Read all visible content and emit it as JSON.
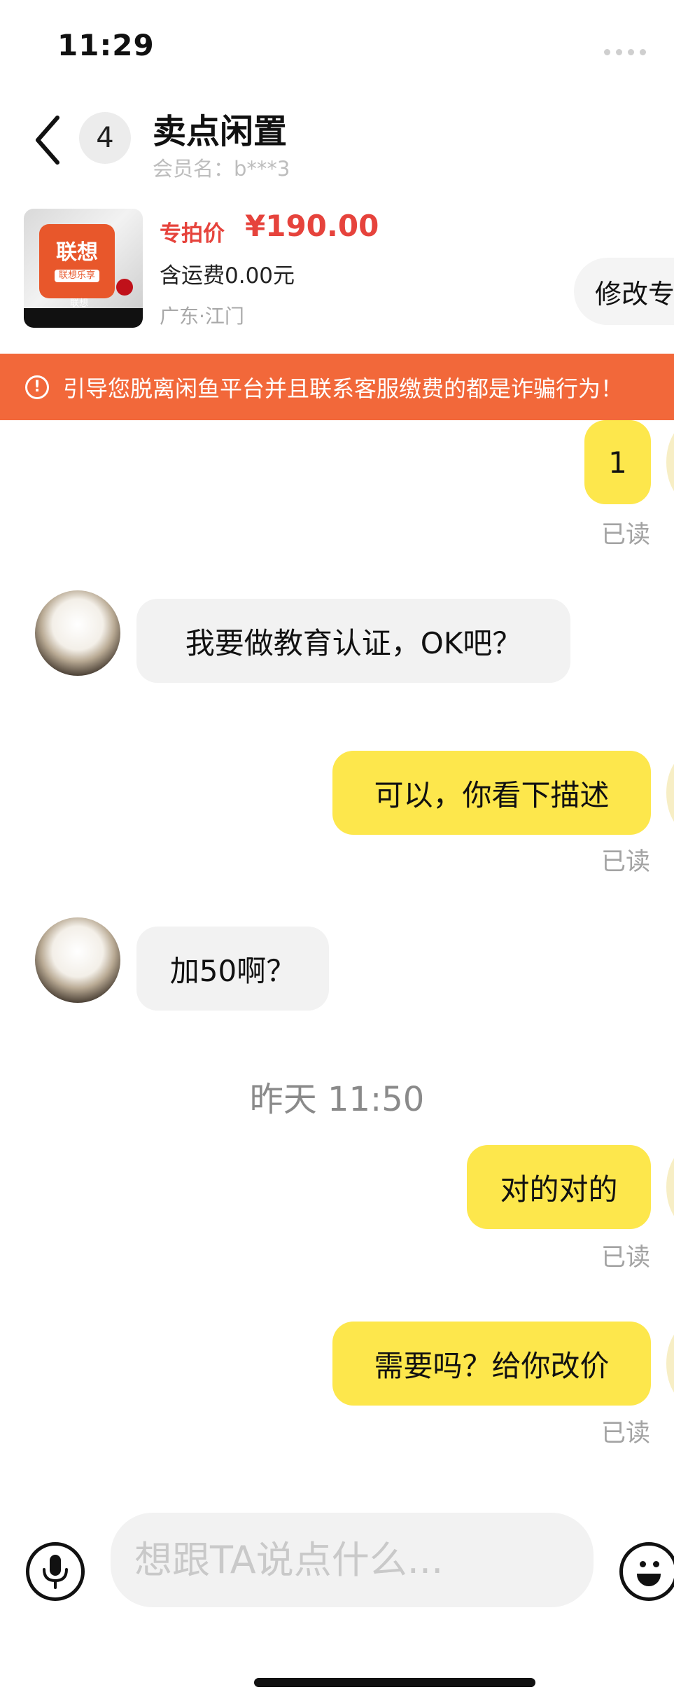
{
  "status_bar": {
    "time": "11:29"
  },
  "header": {
    "back_label": "<",
    "unread_count": "4",
    "title": "卖点闲置",
    "member": "会员名：b***3"
  },
  "product": {
    "logo_text": "联想",
    "logo_sub": "联想乐享",
    "brand_text": "联想",
    "price_label": "专拍价",
    "price": "¥190.00",
    "shipping": "含运费0.00元",
    "location": "广东·江门",
    "modify_button": "修改专"
  },
  "warning": {
    "icon": "!",
    "text": "引导您脱离闲鱼平台并且联系客服缴费的都是诈骗行为！"
  },
  "messages": [
    {
      "from": "me",
      "text": "1",
      "status": "已读"
    },
    {
      "from": "them",
      "text": "我要做教育认证，OK吧？"
    },
    {
      "from": "me",
      "text": "可以，你看下描述",
      "status": "已读"
    },
    {
      "from": "them",
      "text": "加50啊？"
    },
    {
      "from": "me",
      "text": "对的对的",
      "status": "已读"
    },
    {
      "from": "me",
      "text": "需要吗？给你改价",
      "status": "已读"
    }
  ],
  "timestamp": "昨天 11:50",
  "input": {
    "placeholder": "想跟TA说点什么..."
  },
  "icons": {
    "back": "chevron-left-icon",
    "warning": "info-circle-icon",
    "voice": "microphone-icon",
    "emoji": "smiley-icon"
  },
  "colors": {
    "my_bubble": "#fde74c",
    "their_bubble": "#f2f2f2",
    "warning_bar": "#f2683a",
    "price": "#e6433c"
  }
}
